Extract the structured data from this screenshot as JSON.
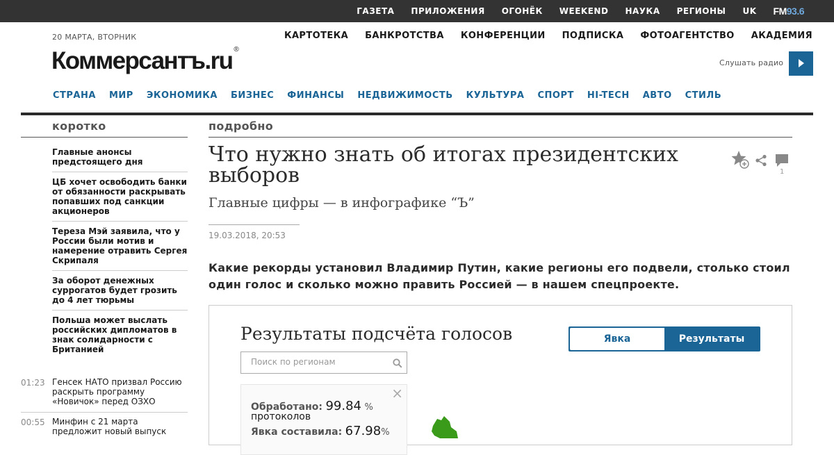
{
  "topbar": {
    "links": [
      "ГАЗЕТА",
      "ПРИЛОЖЕНИЯ",
      "ОГОНЁК",
      "WEEKEND",
      "НАУКА",
      "РЕГИОНЫ",
      "UK"
    ],
    "fm_label": "FM",
    "fm_freq": "93.6"
  },
  "header": {
    "date": "20 МАРТА, ВТОРНИК",
    "logo": "Коммерсантъ.ru",
    "logo_mark": "®",
    "secondary_nav": [
      "КАРТОТЕКА",
      "БАНКРОТСТВА",
      "КОНФЕРЕНЦИИ",
      "ПОДПИСКА",
      "ФОТОАГЕНТСТВО",
      "АКАДЕМИЯ"
    ],
    "radio_label": "Слушать радио"
  },
  "main_nav": [
    "СТРАНА",
    "МИР",
    "ЭКОНОМИКА",
    "БИЗНЕС",
    "ФИНАНСЫ",
    "НЕДВИЖИМОСТЬ",
    "КУЛЬТУРА",
    "СПОРТ",
    "HI-TECH",
    "АВТО",
    "СТИЛЬ"
  ],
  "left": {
    "heading": "коротко",
    "news": [
      "Главные анонсы предстоящего дня",
      "ЦБ хочет освободить банки от обязанности раскрывать попавших под санкции акционеров",
      "Тереза Мэй заявила, что у России были мотив и намерение отравить Сергея Скрипаля",
      "За оборот денежных суррогатов будет грозить до 4 лет тюрьмы",
      "Польша может выслать российских дипломатов в знак солидарности с Британией"
    ],
    "timed_news": [
      {
        "time": "01:23",
        "text": "Генсек НАТО призвал Россию раскрыть программу «Новичок» перед ОЗХО"
      },
      {
        "time": "00:55",
        "text": "Минфин с 21 марта предложит новый выпуск"
      }
    ]
  },
  "article": {
    "section": "подробно",
    "title": "Что нужно знать об итогах президентских выборов",
    "subtitle": "Главные цифры — в инфографике “Ъ”",
    "published": "19.03.2018, 20:53",
    "lead": "Какие рекорды установил Владимир Путин, какие регионы его подвели, столько стоил один голос и сколько можно править Россией — в нашем спецпроекте.",
    "comment_count": "1",
    "icons": [
      "favorite-add-icon",
      "share-icon",
      "comment-icon"
    ]
  },
  "widget": {
    "title": "Результаты подсчёта голосов",
    "toggle_off": "Явка",
    "toggle_on": "Результаты",
    "search_placeholder": "Поиск по регионам",
    "close_glyph": "×",
    "processed_label": "Обработано:",
    "processed_value": "99.84",
    "processed_unit": "%",
    "processed_sub": "протоколов",
    "turnout_label": "Явка составила:",
    "turnout_value": "67.98",
    "turnout_unit": "%",
    "map_color": "#3a9a1a"
  },
  "colors": {
    "accent": "#1a6496",
    "topbar": "#333333",
    "fm_freq": "#6fa8dc"
  }
}
